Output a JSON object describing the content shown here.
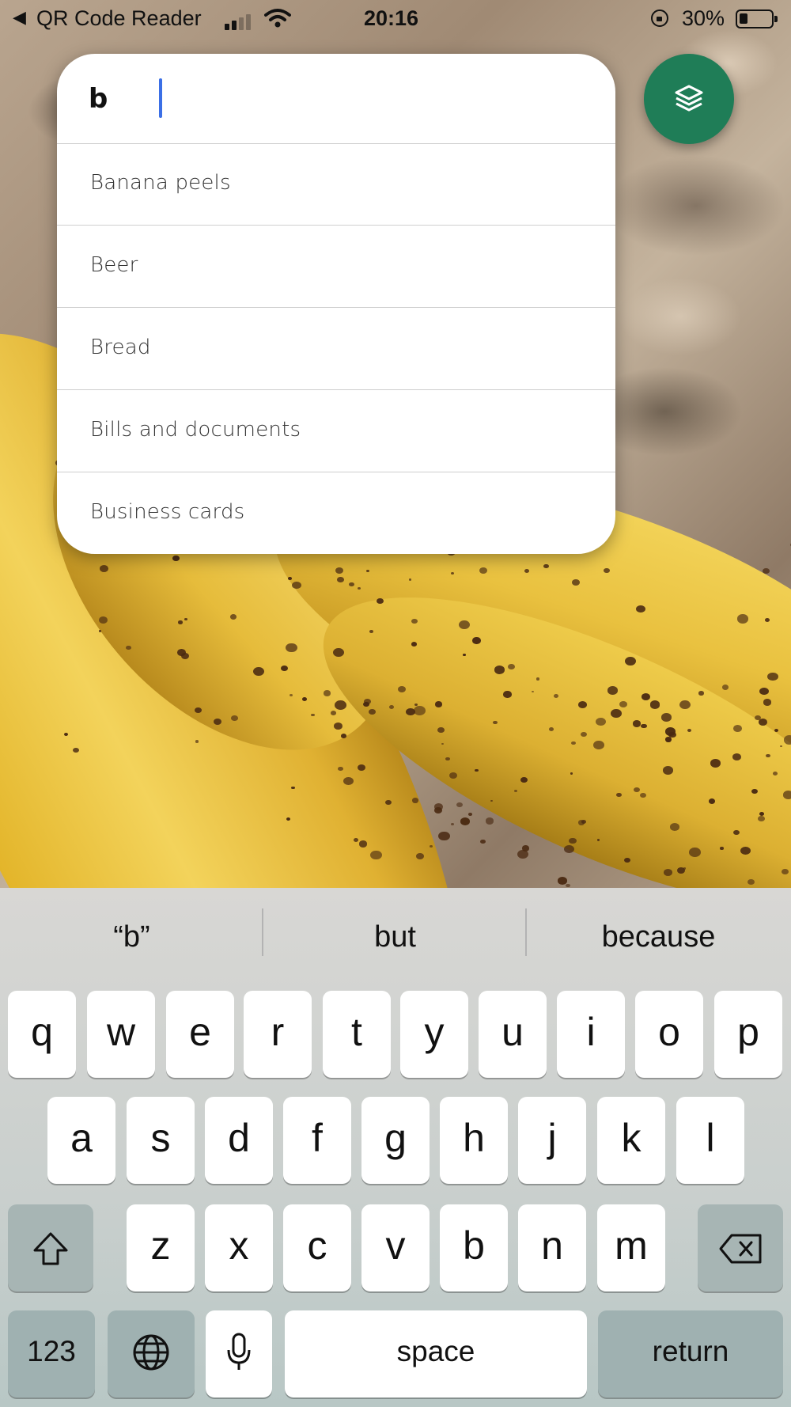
{
  "status_bar": {
    "back_arrow": "◀",
    "app": "QR Code Reader",
    "time": "20:16",
    "battery": "30%",
    "icons": [
      "signal-icon",
      "wifi-icon",
      "orientation-lock-icon",
      "battery-icon"
    ]
  },
  "search": {
    "value": "b",
    "suggestions": [
      "Banana peels",
      "Beer",
      "Bread",
      "Bills and documents",
      "Business cards"
    ]
  },
  "fab": {
    "icon": "layers-icon",
    "color": "#1f7d57"
  },
  "keyboard": {
    "predictions": [
      "“b”",
      "but",
      "because"
    ],
    "row1": [
      "q",
      "w",
      "e",
      "r",
      "t",
      "y",
      "u",
      "i",
      "o",
      "p"
    ],
    "row2": [
      "a",
      "s",
      "d",
      "f",
      "g",
      "h",
      "j",
      "k",
      "l"
    ],
    "row3": [
      "z",
      "x",
      "c",
      "v",
      "b",
      "n",
      "m"
    ],
    "numbers_label": "123",
    "space_label": "space",
    "return_label": "return",
    "icons": [
      "shift-icon",
      "backspace-icon",
      "globe-icon",
      "microphone-icon"
    ]
  }
}
